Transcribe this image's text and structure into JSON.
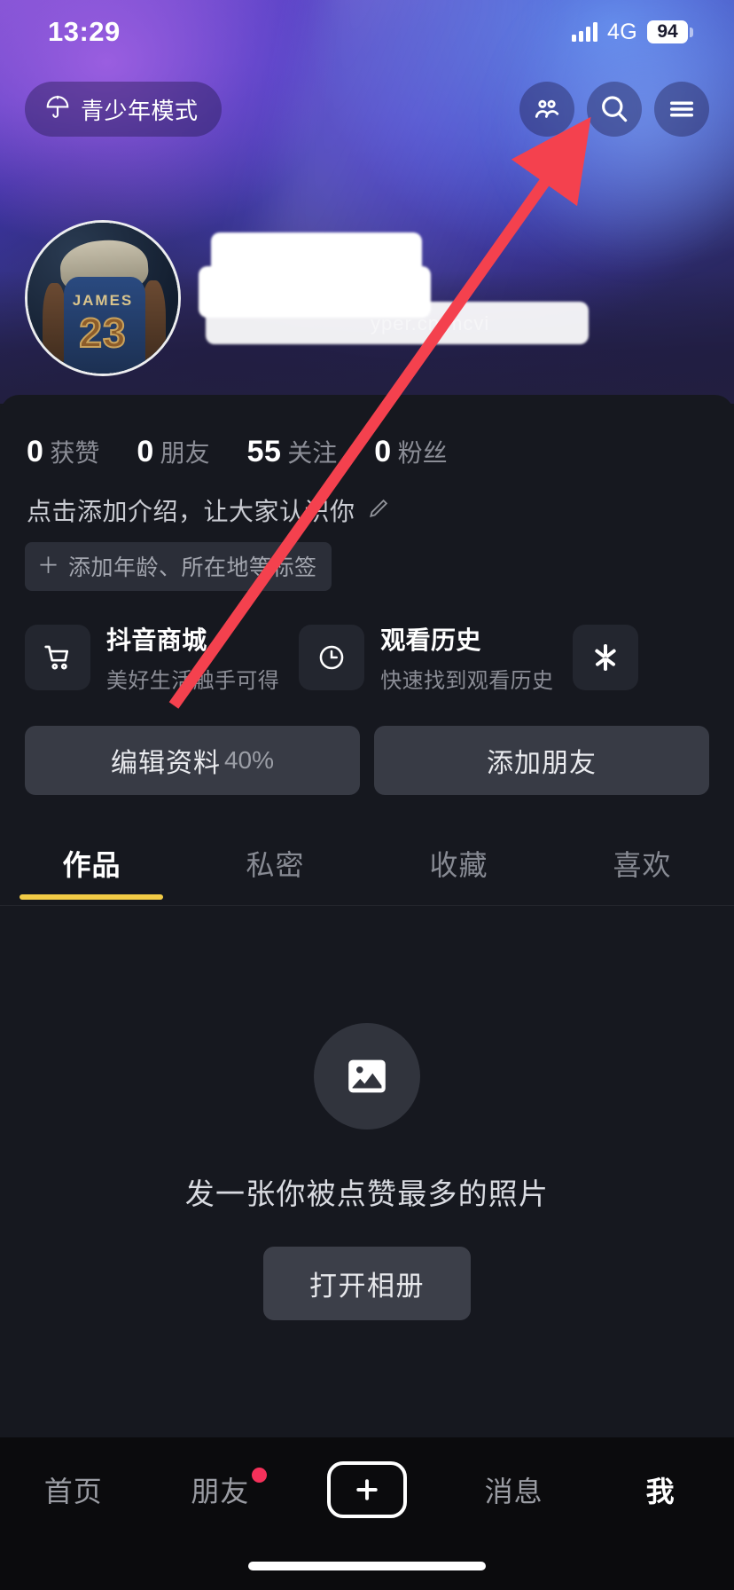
{
  "status_bar": {
    "time": "13:29",
    "network": "4G",
    "battery": "94",
    "signal_icon": "cellular-signal-icon",
    "battery_icon": "battery-icon"
  },
  "banner": {
    "teen_mode": {
      "label": "青少年模式",
      "icon": "umbrella-icon"
    },
    "icons": [
      {
        "name": "friends-icon",
        "label": "朋友"
      },
      {
        "name": "search-icon",
        "label": "搜索"
      },
      {
        "name": "menu-icon",
        "label": "菜单"
      }
    ],
    "avatar": {
      "name": "avatar",
      "jersey_name": "JAMES",
      "jersey_number": "23"
    },
    "nickname_redacted": true,
    "watermark": "yper.cn/mcvi"
  },
  "profile": {
    "stats": [
      {
        "num": "0",
        "label": "获赞"
      },
      {
        "num": "0",
        "label": "朋友"
      },
      {
        "num": "55",
        "label": "关注"
      },
      {
        "num": "0",
        "label": "粉丝"
      }
    ],
    "bio_placeholder": "点击添加介绍，让大家认识你",
    "bio_edit_icon": "pencil-icon",
    "tag_plus": "＋",
    "tag_label": "添加年龄、所在地等标签"
  },
  "cards": [
    {
      "icon": "shopping-cart-icon",
      "title": "抖音商城",
      "subtitle": "美好生活触手可得"
    },
    {
      "icon": "clock-icon",
      "title": "观看历史",
      "subtitle": "快速找到观看历史"
    },
    {
      "icon": "douyin-asterisk-icon",
      "title": "",
      "subtitle": ""
    }
  ],
  "actions": [
    {
      "name": "edit-profile-button",
      "label": "编辑资料",
      "percent": "40%"
    },
    {
      "name": "add-friend-button",
      "label": "添加朋友",
      "percent": ""
    }
  ],
  "tabs": [
    {
      "label": "作品",
      "active": true
    },
    {
      "label": "私密",
      "active": false
    },
    {
      "label": "收藏",
      "active": false
    },
    {
      "label": "喜欢",
      "active": false
    }
  ],
  "empty_state": {
    "icon": "photo-placeholder-icon",
    "text": "发一张你被点赞最多的照片",
    "button": "打开相册"
  },
  "bottom_nav": [
    {
      "label": "首页",
      "active": false,
      "badge": false
    },
    {
      "label": "朋友",
      "active": false,
      "badge": true
    },
    {
      "label": "+",
      "active": false,
      "badge": false,
      "is_plus": true
    },
    {
      "label": "消息",
      "active": false,
      "badge": false
    },
    {
      "label": "我",
      "active": true,
      "badge": false
    }
  ],
  "annotation": {
    "type": "red-arrow",
    "points_to": "menu-icon",
    "color": "#f4414e"
  },
  "colors": {
    "accent_yellow": "#f2cb46",
    "badge_red": "#f5315a",
    "sheet_bg": "#16181f",
    "nav_bg": "#0b0b0d"
  }
}
